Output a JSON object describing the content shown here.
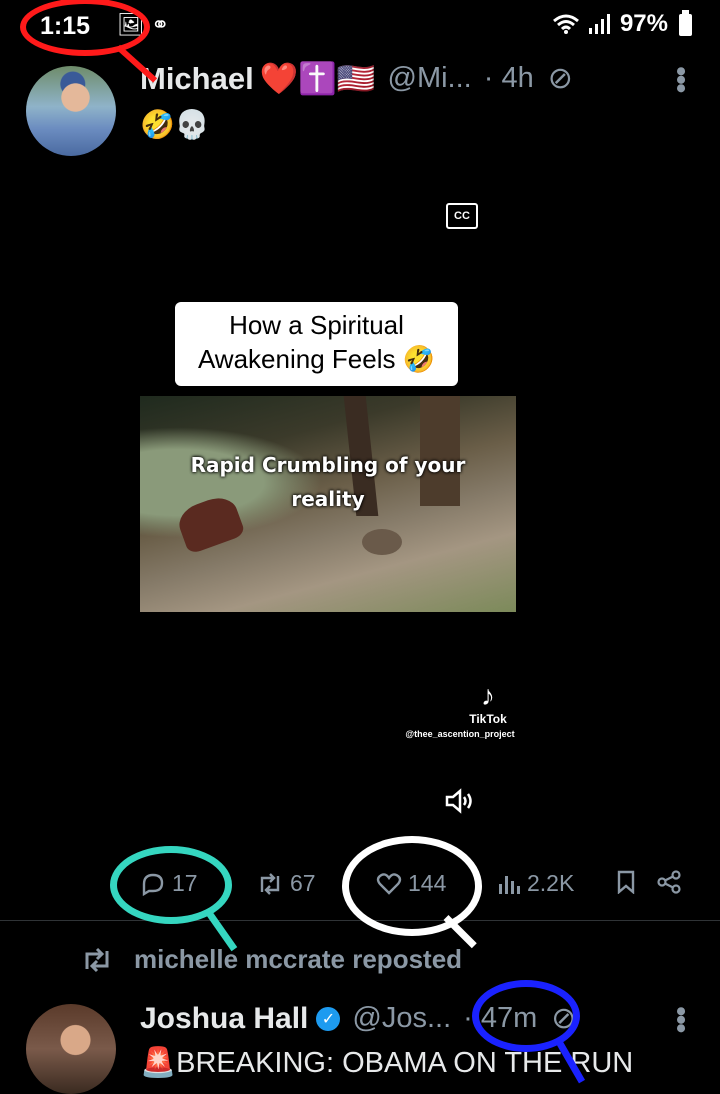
{
  "status_bar": {
    "time": "1:15",
    "left_icons": "🖼 ⚭",
    "signal_icons": "📶",
    "battery": "97%"
  },
  "tweet1": {
    "display_name": "Michael",
    "name_emojis": "❤️✝️🇺🇸",
    "handle": "@Mi...",
    "time": "· 4h",
    "text": "🤣💀",
    "video": {
      "cc_label": "CC",
      "caption_line1": "How a Spiritual",
      "caption_line2": "Awakening Feels 🤣",
      "overlay_line1": "Rapid Crumbling of your",
      "overlay_line2": "reality",
      "tiktok_label": "TikTok",
      "tiktok_user": "@thee_ascention_project"
    },
    "actions": {
      "replies": "17",
      "reposts": "67",
      "likes": "144",
      "views": "2.2K"
    }
  },
  "repost_notice": "michelle mccrate reposted",
  "tweet2": {
    "display_name": "Joshua Hall",
    "handle": "@Jos...",
    "time": "· 47m",
    "text": "🚨BREAKING: OBAMA ON THE RUN"
  },
  "colors": {
    "background": "#000000",
    "muted": "#8b98a5",
    "verified": "#1d9bf0",
    "annotation_red": "#ff1a1a",
    "annotation_teal": "#35d6c0",
    "annotation_white": "#ffffff",
    "annotation_blue": "#1a22ff"
  }
}
